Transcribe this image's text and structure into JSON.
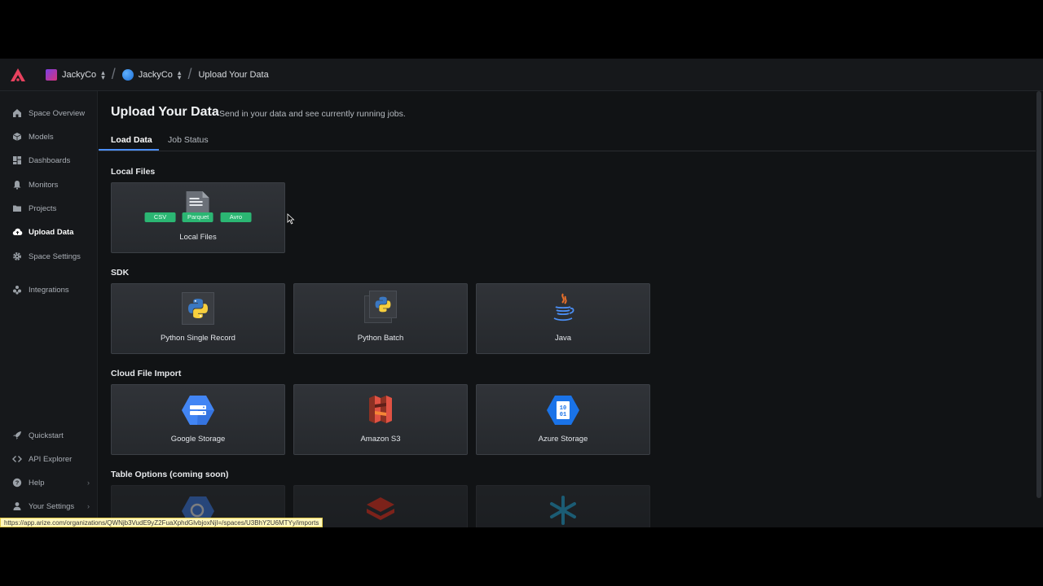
{
  "header": {
    "org": "JackyCo",
    "space": "JackyCo",
    "page": "Upload Your Data"
  },
  "sidebar": {
    "items": [
      {
        "label": "Space Overview",
        "icon": "home-icon"
      },
      {
        "label": "Models",
        "icon": "cube-icon"
      },
      {
        "label": "Dashboards",
        "icon": "grid-icon"
      },
      {
        "label": "Monitors",
        "icon": "bell-icon"
      },
      {
        "label": "Projects",
        "icon": "folder-icon"
      },
      {
        "label": "Upload Data",
        "icon": "cloud-upload-icon",
        "active": true
      },
      {
        "label": "Space Settings",
        "icon": "gear-icon"
      },
      {
        "label": "Integrations",
        "icon": "puzzle-icon"
      }
    ],
    "bottom_items": [
      {
        "label": "Quickstart",
        "icon": "rocket-icon"
      },
      {
        "label": "API Explorer",
        "icon": "code-icon"
      },
      {
        "label": "Help",
        "icon": "help-icon"
      },
      {
        "label": "Your Settings",
        "icon": "user-icon"
      }
    ]
  },
  "main": {
    "title": "Upload Your Data",
    "subtitle": "Send in your data and see currently running jobs.",
    "tabs": [
      {
        "label": "Load Data",
        "active": true
      },
      {
        "label": "Job Status"
      }
    ],
    "sections": {
      "local": {
        "label": "Local Files",
        "cards": [
          {
            "label": "Local Files",
            "chips": [
              "CSV",
              "Parquet",
              "Avro"
            ]
          }
        ]
      },
      "sdk": {
        "label": "SDK",
        "cards": [
          {
            "label": "Python Single Record"
          },
          {
            "label": "Python Batch"
          },
          {
            "label": "Java"
          }
        ]
      },
      "cloud": {
        "label": "Cloud File Import",
        "cards": [
          {
            "label": "Google Storage"
          },
          {
            "label": "Amazon S3"
          },
          {
            "label": "Azure Storage"
          }
        ]
      },
      "table": {
        "label": "Table Options (coming soon)"
      }
    }
  },
  "status_url": "https://app.arize.com/organizations/QWNjb3VudE9yZ2FuaXphdGlvbjoxNjI=/spaces/U3BhY2U6MTYy/imports",
  "colors": {
    "accent": "#4b8ef5",
    "brand": "#e8415e",
    "chip": "#2bb673"
  }
}
